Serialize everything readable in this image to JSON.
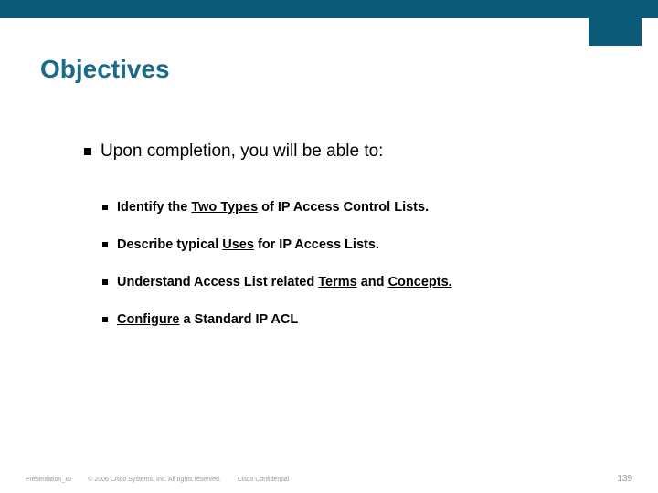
{
  "colors": {
    "brand": "#0a5a78",
    "title": "#1a6a8a",
    "footer": "#999999"
  },
  "title": "Objectives",
  "main_bullet": "Upon completion, you will be able to:",
  "sub": [
    {
      "pre": "Identify the ",
      "u1": "Two Types",
      "post": " of IP Access Control Lists."
    },
    {
      "pre": "Describe typical ",
      "u1": "Uses",
      "post": " for IP Access Lists."
    },
    {
      "pre": "Understand Access List related ",
      "u1": "Terms",
      "mid": " and ",
      "u2": "Concepts.",
      "post": ""
    },
    {
      "pre": "",
      "u1": "Configure",
      "post": " a Standard IP ACL"
    }
  ],
  "footer": {
    "presentation_id": "Presentation_ID",
    "copyright": "© 2006 Cisco Systems, Inc. All rights reserved.",
    "confidential": "Cisco Confidential",
    "page": "139"
  }
}
